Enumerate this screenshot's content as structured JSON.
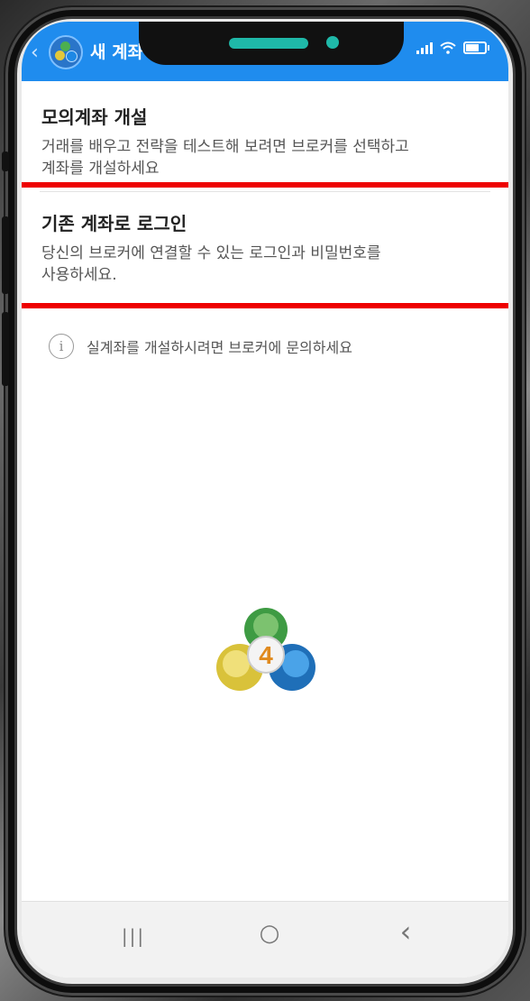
{
  "header": {
    "back_glyph": "‹",
    "title": "새 계좌",
    "app_icon": "metatrader-4-icon"
  },
  "status_bar": {
    "signal_icon": "signal-icon",
    "wifi_icon": "wifi-icon",
    "battery_icon": "battery-icon"
  },
  "options": [
    {
      "title": "모의계좌 개설",
      "description_line1": "거래를 배우고 전략을 테스트해 보려면 브로커를 선택하고",
      "description_line2": "계좌를 개설하세요"
    },
    {
      "title": "기존 계좌로 로그인",
      "description_line1": "당신의 브로커에 연결할 수 있는 로그인과 비밀번호를",
      "description_line2": "사용하세요."
    }
  ],
  "info": {
    "icon_glyph": "i",
    "text": "실계좌를 개설하시려면 브로커에 문의하세요"
  },
  "logo": {
    "badge_number": "4"
  },
  "navbar": {
    "recents_glyph": "|||",
    "home_glyph": "○",
    "back_glyph": "‹"
  },
  "colors": {
    "header_blue": "#1f8cee",
    "highlight_red": "#ee0000"
  }
}
